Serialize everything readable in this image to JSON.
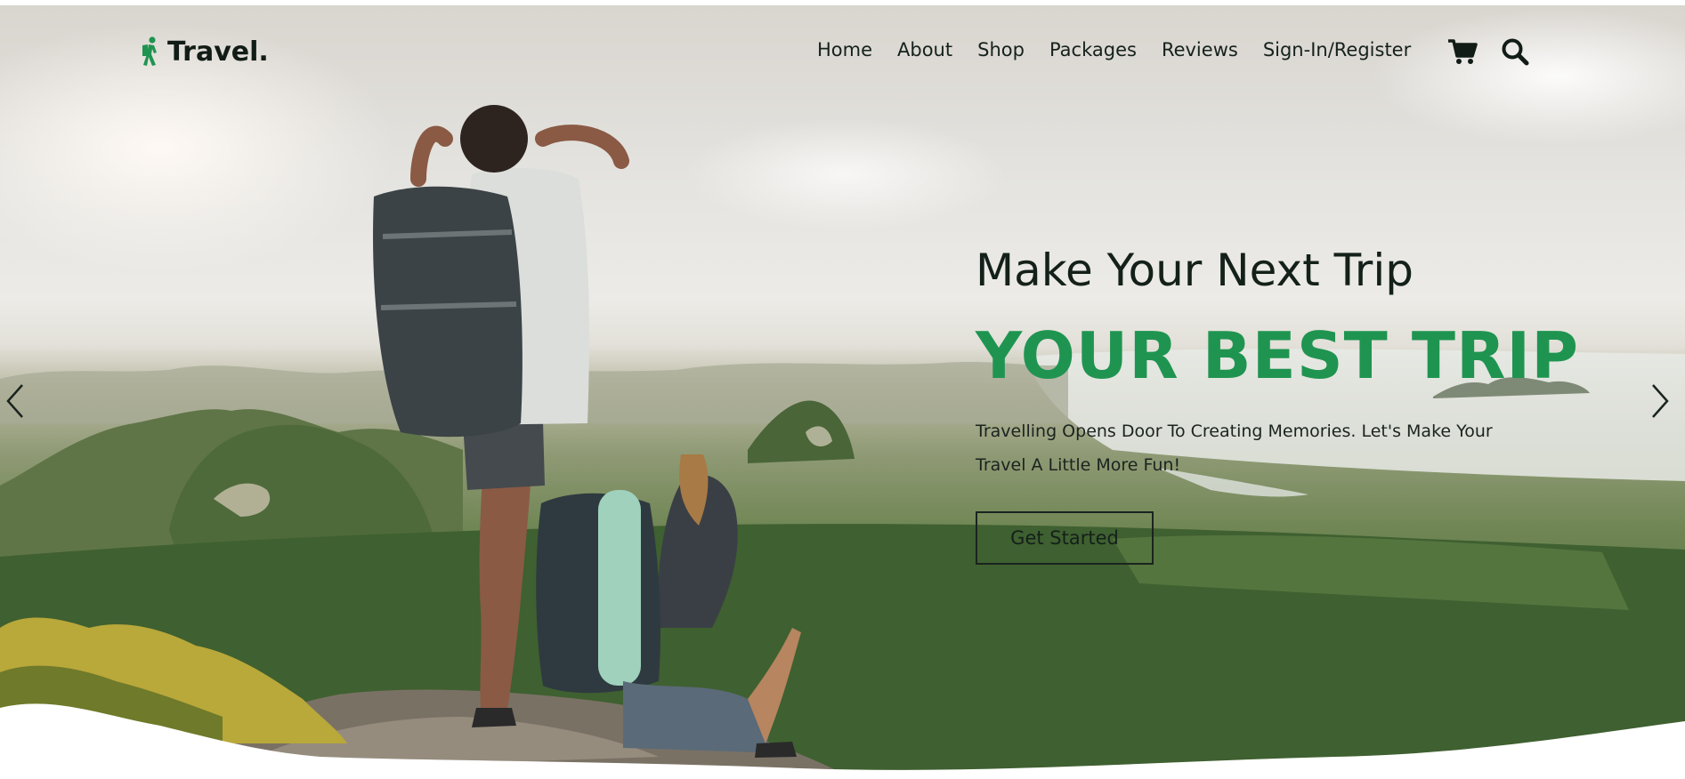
{
  "brand": {
    "name": "Travel."
  },
  "nav": {
    "links": [
      "Home",
      "About",
      "Shop",
      "Packages",
      "Reviews",
      "Sign-In/Register"
    ]
  },
  "icons": {
    "cart": "cart-icon",
    "search": "search-icon",
    "logo": "hiker-icon",
    "prev": "chevron-left-icon",
    "next": "chevron-right-icon"
  },
  "hero": {
    "subheading": "Make Your Next Trip",
    "heading": "YOUR BEST TRIP",
    "description": "Travelling Opens Door To Creating Memories. Let's Make Your Travel A Little More Fun!",
    "cta_label": "Get Started"
  },
  "colors": {
    "accent": "#1f9450",
    "text": "#14201a"
  }
}
